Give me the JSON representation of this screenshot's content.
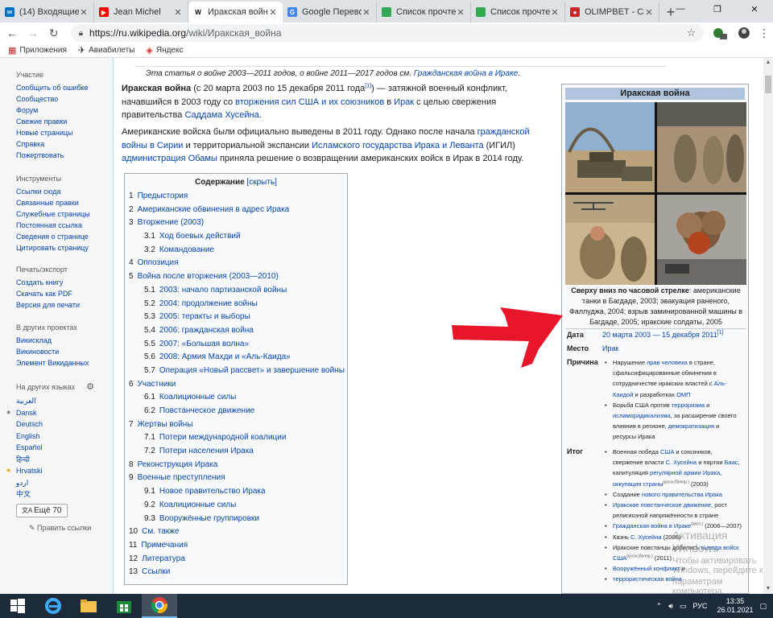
{
  "browser": {
    "tabs": [
      {
        "title": "(14) Входящие - ",
        "icon": "mail-icon",
        "color": "#0072c6",
        "glyph": "✉"
      },
      {
        "title": "Jean Michel",
        "icon": "youtube-icon",
        "color": "#ff0000",
        "glyph": "▶"
      },
      {
        "title": "Иракская война",
        "icon": "wikipedia-icon",
        "color": "#fff",
        "glyph": "W",
        "active": true
      },
      {
        "title": "Google Переводч",
        "icon": "translate-icon",
        "color": "#4285f4",
        "glyph": "G"
      },
      {
        "title": "Список прочтен",
        "icon": "sheet-icon",
        "color": "#34a853",
        "glyph": ""
      },
      {
        "title": "Список прочтен",
        "icon": "sheet-icon",
        "color": "#34a853",
        "glyph": ""
      },
      {
        "title": "OLIMPBET - Спо",
        "icon": "olimpbet-icon",
        "color": "#c62828",
        "glyph": "●"
      }
    ],
    "url_host": "https://ru.wikipedia.org",
    "url_path": "/wiki/Иракская_война",
    "bookmarks": [
      {
        "label": "Приложения",
        "icon": "apps-icon"
      },
      {
        "label": "Авиабилеты",
        "icon": "plane-icon"
      },
      {
        "label": "Яндекс",
        "icon": "yandex-icon"
      }
    ]
  },
  "sidebar": {
    "sections": [
      {
        "heading": "Участие",
        "links": [
          "Сообщить об ошибке",
          "Сообщество",
          "Форум",
          "Свежие правки",
          "Новые страницы",
          "Справка",
          "Пожертвовать"
        ]
      },
      {
        "heading": "Инструменты",
        "links": [
          "Ссылки сюда",
          "Связанные правки",
          "Служебные страницы",
          "Постоянная ссылка",
          "Сведения о странице",
          "Цитировать страницу"
        ]
      },
      {
        "heading": "Печать/экспорт",
        "links": [
          "Создать книгу",
          "Скачать как PDF",
          "Версия для печати"
        ]
      },
      {
        "heading": "В других проектах",
        "links": [
          "Викисклад",
          "Викиновости",
          "Элемент Викиданных"
        ]
      }
    ],
    "languages_heading": "На других языках",
    "languages": [
      {
        "name": "العربية",
        "star": false
      },
      {
        "name": "Dansk",
        "star": true
      },
      {
        "name": "Deutsch",
        "star": false
      },
      {
        "name": "English",
        "star": false
      },
      {
        "name": "Español",
        "star": false
      },
      {
        "name": "हिन्दी",
        "star": false
      },
      {
        "name": "Hrvatski",
        "star": true
      },
      {
        "name": "اردو",
        "star": false
      },
      {
        "name": "中文",
        "star": false
      }
    ],
    "more_languages": "Ещё 70",
    "edit_links": "Править ссылки"
  },
  "article": {
    "hatnote_prefix": "Эта статья о войне 2003—2011 годов, о войне 2011—2017 годов см. ",
    "hatnote_link": "Гражданская война в Ираке",
    "hatnote_suffix": ".",
    "p1": {
      "bold": "Иракская война",
      "t1": " (с 20 марта 2003 по 15 декабря 2011 года",
      "ref": "[1]",
      "t2": ") — затяжной военный конфликт, начавшийся в 2003 году со ",
      "l1": "вторжения сил США и их союзников",
      "t3": " в ",
      "l2": "Ирак",
      "t4": " с целью свержения правительства ",
      "l3": "Саддама Хусейна",
      "t5": "."
    },
    "p2": {
      "t1": "Американские войска были официально выведены в 2011 году. Однако после начала ",
      "l1": "гражданской войны в Сирии",
      "t2": " и территориальной экспансии ",
      "l2": "Исламского государства Ирака и Леванта",
      "t3": " (ИГИЛ) ",
      "l3": "администрация Обамы",
      "t4": " приняла решение о возвращении американских войск в Ирак в 2014 году."
    }
  },
  "toc": {
    "title": "Содержание",
    "hide_label": "[скрыть]",
    "items": [
      {
        "num": "1",
        "label": "Предыстория",
        "level": 1
      },
      {
        "num": "2",
        "label": "Американские обвинения в адрес Ирака",
        "level": 1
      },
      {
        "num": "3",
        "label": "Вторжение (2003)",
        "level": 1
      },
      {
        "num": "3.1",
        "label": "Ход боевых действий",
        "level": 2
      },
      {
        "num": "3.2",
        "label": "Командование",
        "level": 2
      },
      {
        "num": "4",
        "label": "Оппозиция",
        "level": 1
      },
      {
        "num": "5",
        "label": "Война после вторжения (2003—2010)",
        "level": 1
      },
      {
        "num": "5.1",
        "label": "2003: начало партизанской войны",
        "level": 2
      },
      {
        "num": "5.2",
        "label": "2004: продолжение войны",
        "level": 2
      },
      {
        "num": "5.3",
        "label": "2005: теракты и выборы",
        "level": 2
      },
      {
        "num": "5.4",
        "label": "2006: гражданская война",
        "level": 2
      },
      {
        "num": "5.5",
        "label": "2007: «Большая волна»",
        "level": 2
      },
      {
        "num": "5.6",
        "label": "2008: Армия Махди и «Аль-Каида»",
        "level": 2
      },
      {
        "num": "5.7",
        "label": "Операция «Новый рассвет» и завершение войны",
        "level": 2
      },
      {
        "num": "6",
        "label": "Участники",
        "level": 1
      },
      {
        "num": "6.1",
        "label": "Коалиционные силы",
        "level": 2
      },
      {
        "num": "6.2",
        "label": "Повстанческое движение",
        "level": 2
      },
      {
        "num": "7",
        "label": "Жертвы войны",
        "level": 1
      },
      {
        "num": "7.1",
        "label": "Потери международной коалиции",
        "level": 2
      },
      {
        "num": "7.2",
        "label": "Потери населения Ирака",
        "level": 2
      },
      {
        "num": "8",
        "label": "Реконструкция Ирака",
        "level": 1
      },
      {
        "num": "9",
        "label": "Военные преступления",
        "level": 1
      },
      {
        "num": "9.1",
        "label": "Новое правительство Ирака",
        "level": 2
      },
      {
        "num": "9.2",
        "label": "Коалиционные силы",
        "level": 2
      },
      {
        "num": "9.3",
        "label": "Вооружённые группировки",
        "level": 2
      },
      {
        "num": "10",
        "label": "См. также",
        "level": 1
      },
      {
        "num": "11",
        "label": "Примечания",
        "level": 1
      },
      {
        "num": "12",
        "label": "Литература",
        "level": 1
      },
      {
        "num": "13",
        "label": "Ссылки",
        "level": 1
      }
    ]
  },
  "infobox": {
    "title": "Иракская война",
    "caption_bold": "Сверху вниз по часовой стрелке",
    "caption_text": ": американские танки в Багдаде, 2003; эвакуация раненого, Фаллуджа, 2004; взрыв заминированной машины в Багдаде, 2005; иракские солдаты, 2005",
    "date_label": "Дата",
    "date_value": "20 марта 2003 — 15 декабря 2011",
    "date_ref": "[1]",
    "place_label": "Место",
    "place_value": "Ирак",
    "cause_label": "Причина",
    "causes": [
      {
        "parts": [
          [
            "t",
            "Нарушение "
          ],
          [
            "a",
            "прав человека"
          ],
          [
            "t",
            " в стране, сфальсифицированные обвинения в сотрудничестве иракских властей с "
          ],
          [
            "a",
            "Аль-Каидой"
          ],
          [
            "t",
            " и разработках "
          ],
          [
            "a",
            "ОМП"
          ]
        ]
      },
      {
        "parts": [
          [
            "t",
            "Борьба США против "
          ],
          [
            "a",
            "терроризма"
          ],
          [
            "t",
            " и "
          ],
          [
            "a",
            "исламорадикализма"
          ],
          [
            "t",
            ", за расширение своего влияния в регионе, "
          ],
          [
            "a",
            "демократизация"
          ],
          [
            "t",
            " и ресурсы Ирака"
          ]
        ]
      }
    ],
    "result_label": "Итог",
    "results": [
      {
        "parts": [
          [
            "t",
            "Военная победа "
          ],
          [
            "a",
            "США"
          ],
          [
            "t",
            " и союзников, свержение власти "
          ],
          [
            "a",
            "С. Хусейна"
          ],
          [
            "t",
            " и партии "
          ],
          [
            "a",
            "Баас"
          ],
          [
            "t",
            ", капитуляция "
          ],
          [
            "a",
            "регулярной армии Ирака"
          ],
          [
            "t",
            ", "
          ],
          [
            "a",
            "оккупация страны"
          ],
          [
            "r",
            "русск."
          ],
          [
            "r",
            "(белор.)"
          ],
          [
            "t",
            " (2003)"
          ]
        ]
      },
      {
        "parts": [
          [
            "t",
            "Создание "
          ],
          [
            "a",
            "нового правительства Ирака"
          ]
        ]
      },
      {
        "parts": [
          [
            "a",
            "Иракское повстанческое движение"
          ],
          [
            "t",
            ", рост религиозной напряжённости в стране"
          ]
        ]
      },
      {
        "parts": [
          [
            "a",
            "Гражданская война в Ираке"
          ],
          [
            "r",
            "(англ.)"
          ],
          [
            "t",
            " (2006—2007)"
          ]
        ]
      },
      {
        "parts": [
          [
            "t",
            "Казнь "
          ],
          [
            "a",
            "С. Хусейна"
          ],
          [
            "t",
            " (2006)"
          ]
        ]
      },
      {
        "parts": [
          [
            "t",
            "Иракские повстанцы добились "
          ],
          [
            "a",
            "вывода войск США"
          ],
          [
            "r",
            "русск."
          ],
          [
            "r",
            "(белор.)"
          ],
          [
            "t",
            " (2011)"
          ]
        ]
      },
      {
        "parts": [
          [
            "a",
            "Вооружённый конфликт"
          ],
          [
            "t",
            " и"
          ]
        ]
      },
      {
        "parts": [
          [
            "a",
            "террористическая война"
          ]
        ]
      }
    ]
  },
  "watermark": {
    "line1": "Активация Windows",
    "line2": "Чтобы активировать Windows, перейдите к",
    "line3": "параметрам компьютера."
  },
  "taskbar": {
    "apps": [
      {
        "name": "start-button",
        "icon": "windows-logo-icon"
      },
      {
        "name": "ie-button",
        "icon": "internet-explorer-icon"
      },
      {
        "name": "explorer-button",
        "icon": "folder-icon"
      },
      {
        "name": "store-button",
        "icon": "store-icon"
      },
      {
        "name": "chrome-button",
        "icon": "chrome-icon",
        "active": true
      }
    ],
    "lang": "РУС",
    "time": "13:35",
    "date": "26.01.2021"
  },
  "arrow_color": "#e8162a"
}
